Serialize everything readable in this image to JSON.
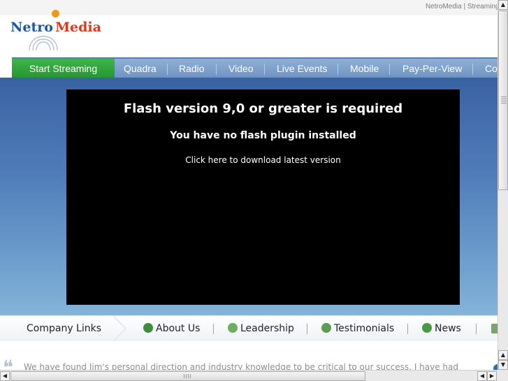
{
  "top_links": {
    "text": "NetroMedia | Streaming"
  },
  "logo": {
    "part1": "Netro",
    "part2": "Media"
  },
  "nav": {
    "items": [
      "Start Streaming",
      "Quadra",
      "Radio",
      "Video",
      "Live Events",
      "Mobile",
      "Pay-Per-View",
      "Co"
    ]
  },
  "flash": {
    "heading": "Flash version 9,0 or greater is required",
    "subheading": "You have no flash plugin installed",
    "link": "Click here to download latest version"
  },
  "company_links": {
    "label": "Company Links",
    "items": [
      {
        "label": "About Us",
        "icon": "help-icon"
      },
      {
        "label": "Leadership",
        "icon": "leadership-icon"
      },
      {
        "label": "Testimonials",
        "icon": "people-icon"
      },
      {
        "label": "News",
        "icon": "speech-bubble-icon"
      }
    ]
  },
  "testimonial": {
    "text": "We have found Jim's personal direction and industry knowledge to be critical to our success. I have had"
  },
  "colors": {
    "nav_active": "#2fa83a",
    "nav_bar": "#7a9ccb",
    "hero": "#4f7cb8"
  }
}
